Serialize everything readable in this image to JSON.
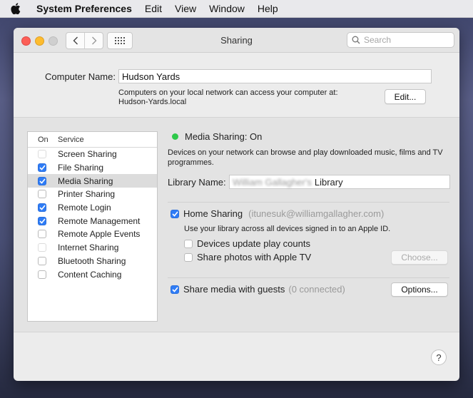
{
  "menubar": {
    "app_name": "System Preferences",
    "items": [
      "Edit",
      "View",
      "Window",
      "Help"
    ]
  },
  "window": {
    "title": "Sharing",
    "search_placeholder": "Search"
  },
  "computer_name": {
    "label": "Computer Name:",
    "value": "Hudson Yards",
    "note_line1": "Computers on your local network can access your computer at:",
    "note_line2": "Hudson-Yards.local",
    "edit_button": "Edit..."
  },
  "services": {
    "col_on": "On",
    "col_service": "Service",
    "items": [
      {
        "label": "Screen Sharing",
        "checked": false
      },
      {
        "label": "File Sharing",
        "checked": true
      },
      {
        "label": "Media Sharing",
        "checked": true,
        "selected": true
      },
      {
        "label": "Printer Sharing",
        "checked": false
      },
      {
        "label": "Remote Login",
        "checked": true
      },
      {
        "label": "Remote Management",
        "checked": true
      },
      {
        "label": "Remote Apple Events",
        "checked": false
      },
      {
        "label": "Internet Sharing",
        "checked": false
      },
      {
        "label": "Bluetooth Sharing",
        "checked": false
      },
      {
        "label": "Content Caching",
        "checked": false
      }
    ]
  },
  "media_sharing": {
    "status": "Media Sharing: On",
    "status_color": "#2ec94a",
    "description": "Devices on your network can browse and play downloaded music, films and TV programmes.",
    "library_label": "Library Name:",
    "library_owner_blurred": "William Gallagher's",
    "library_suffix": "Library",
    "home_sharing_label": "Home Sharing",
    "home_sharing_account": "(itunesuk@williamgallagher.com)",
    "home_sharing_note": "Use your library across all devices signed in to an Apple ID.",
    "devices_update_label": "Devices update play counts",
    "share_photos_label": "Share photos with Apple TV",
    "choose_button": "Choose...",
    "guests_label": "Share media with guests",
    "guests_count": "(0 connected)",
    "options_button": "Options..."
  },
  "help_button": "?",
  "colors": {
    "accent": "#2f7cf6",
    "close": "#fc5f57",
    "minimize": "#fdbc2e"
  }
}
